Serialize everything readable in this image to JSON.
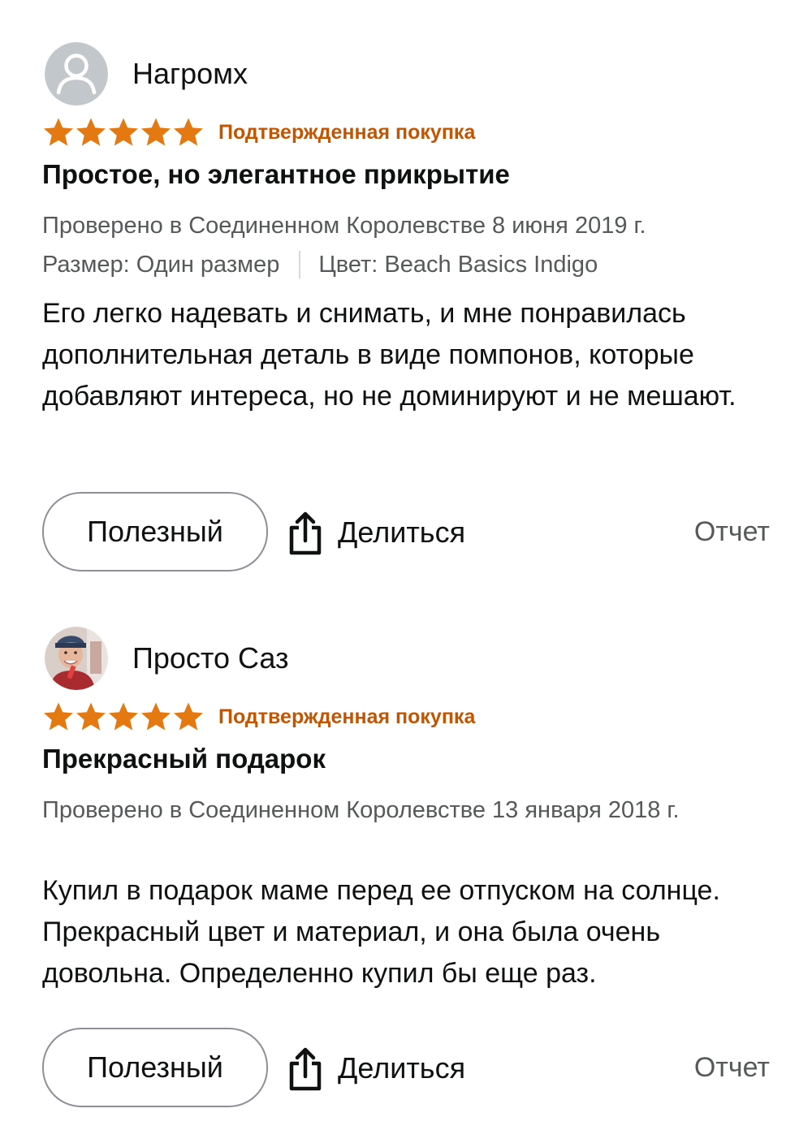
{
  "reviews": [
    {
      "reviewer": "Нагромх",
      "avatar": "default-avatar-icon",
      "rating": 5,
      "rating_max": 5,
      "verified_label": "Подтвержденная покупка",
      "title": "Простое, но элегантное прикрытие",
      "date": "Проверено в Соединенном Королевстве 8 июня 2019 г.",
      "size": "Размер: Один размер",
      "color": "Цвет: Beach Basics Indigo",
      "body": "Его легко надевать и снимать, и мне понравилась дополнительная деталь в виде помпонов, которые добавляют интереса, но не доминируют и не мешают.",
      "helpful_label": "Полезный",
      "share_label": "Делиться",
      "report_label": "Отчет"
    },
    {
      "reviewer": "Просто Саз",
      "avatar": "user-photo-avatar",
      "rating": 5,
      "rating_max": 5,
      "verified_label": "Подтвержденная покупка",
      "title": "Прекрасный подарок",
      "date": "Проверено в Соединенном Королевстве 13 января 2018 г.",
      "body": "Купил в подарок маме перед ее отпуском на солнце. Прекрасный цвет и материал, и она была очень довольна. Определенно купил бы еще раз.",
      "helpful_label": "Полезный",
      "share_label": "Делиться",
      "report_label": "Отчет"
    }
  ],
  "colors": {
    "star": "#e47911",
    "verified": "#c45500",
    "secondary_text": "#565959",
    "primary_text": "#0f1111",
    "button_border": "#8d9096"
  },
  "icons": {
    "star": "star-icon",
    "share": "share-icon"
  }
}
